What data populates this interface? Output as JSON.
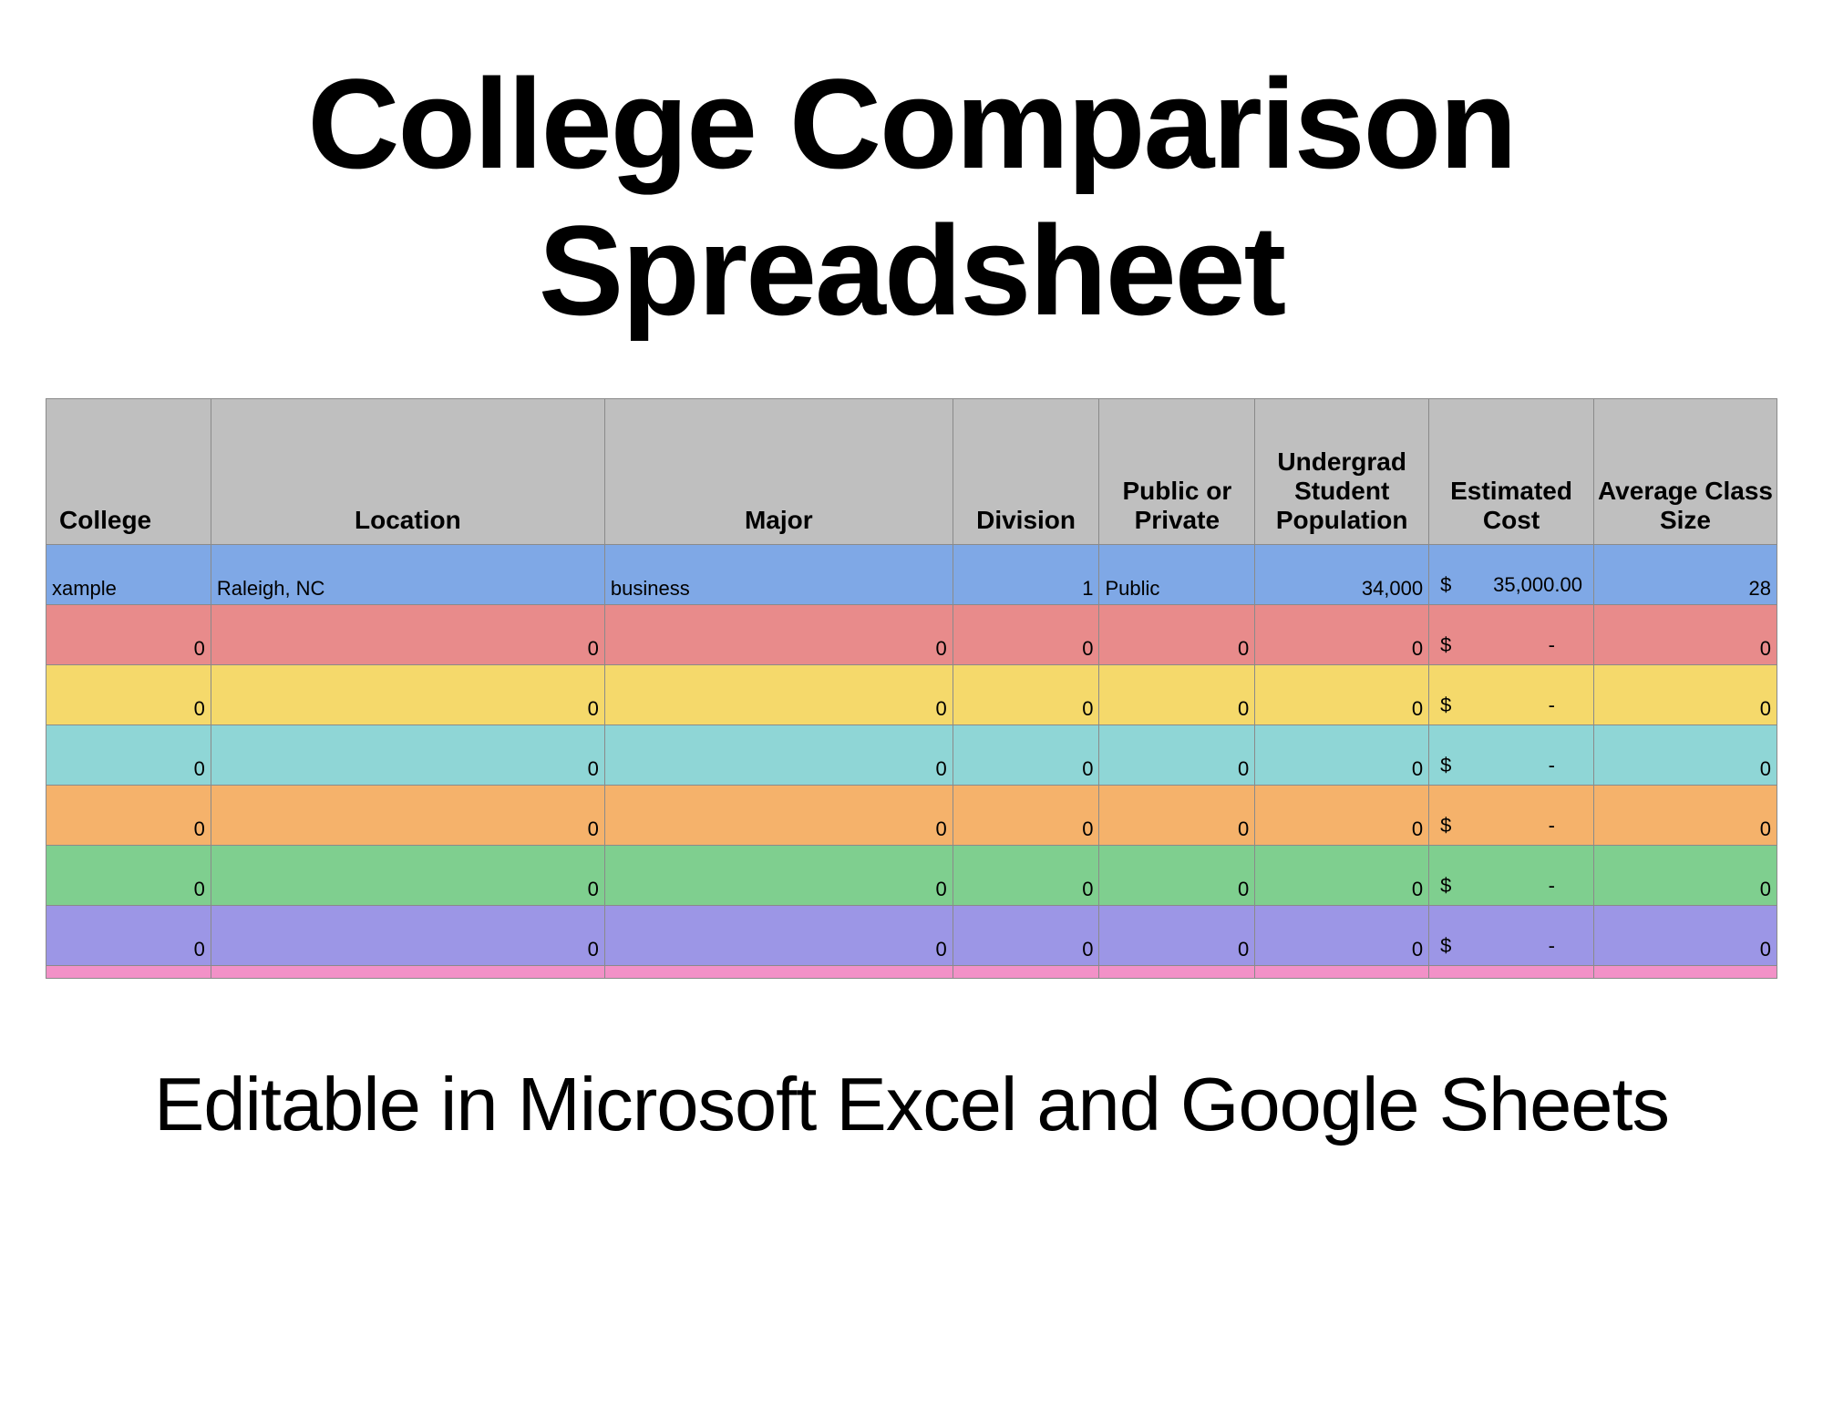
{
  "title_line1": "College Comparison",
  "title_line2": "Spreadsheet",
  "footer": "Editable in Microsoft Excel and Google Sheets",
  "headers": {
    "college": "College",
    "location": "Location",
    "major": "Major",
    "division": "Division",
    "pubpriv": "Public or Private",
    "population": "Undergrad Student Population",
    "cost": "Estimated Cost",
    "classsize": "Average Class Size"
  },
  "rows": [
    {
      "color": "r-blue",
      "college": "xample",
      "location": "Raleigh, NC",
      "major": "business",
      "division": "1",
      "pubpriv": "Public",
      "population": "34,000",
      "cost_symbol": "$",
      "cost_value": "35,000.00",
      "classsize": "28"
    },
    {
      "color": "r-red",
      "college": "0",
      "location": "0",
      "major": "0",
      "division": "0",
      "pubpriv": "0",
      "population": "0",
      "cost_symbol": "$",
      "cost_value": "-",
      "classsize": "0"
    },
    {
      "color": "r-yellow",
      "college": "0",
      "location": "0",
      "major": "0",
      "division": "0",
      "pubpriv": "0",
      "population": "0",
      "cost_symbol": "$",
      "cost_value": "-",
      "classsize": "0"
    },
    {
      "color": "r-teal",
      "college": "0",
      "location": "0",
      "major": "0",
      "division": "0",
      "pubpriv": "0",
      "population": "0",
      "cost_symbol": "$",
      "cost_value": "-",
      "classsize": "0"
    },
    {
      "color": "r-orange",
      "college": "0",
      "location": "0",
      "major": "0",
      "division": "0",
      "pubpriv": "0",
      "population": "0",
      "cost_symbol": "$",
      "cost_value": "-",
      "classsize": "0"
    },
    {
      "color": "r-green",
      "college": "0",
      "location": "0",
      "major": "0",
      "division": "0",
      "pubpriv": "0",
      "population": "0",
      "cost_symbol": "$",
      "cost_value": "-",
      "classsize": "0"
    },
    {
      "color": "r-purple",
      "college": "0",
      "location": "0",
      "major": "0",
      "division": "0",
      "pubpriv": "0",
      "population": "0",
      "cost_symbol": "$",
      "cost_value": "-",
      "classsize": "0"
    }
  ],
  "pink_strip": true
}
